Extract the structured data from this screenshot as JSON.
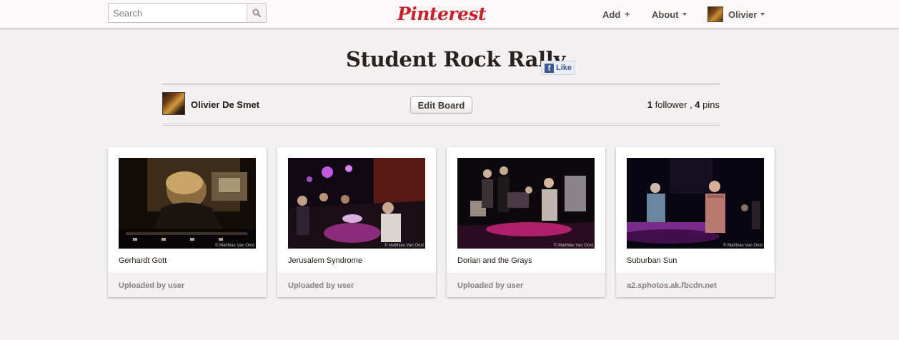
{
  "header": {
    "search_placeholder": "Search",
    "logo_text": "Pinterest",
    "add_label": "Add",
    "add_symbol": "+",
    "about_label": "About",
    "user_label": "Olivier",
    "brand_color": "#c8232c"
  },
  "board": {
    "title": "Student Rock Rally",
    "like_label": "Like",
    "fb_glyph": "f",
    "owner_name": "Olivier De Smet",
    "edit_label": "Edit Board",
    "followers_count": "1",
    "followers_word": " follower , ",
    "pins_count": "4",
    "pins_word": " pins"
  },
  "pins": [
    {
      "description": "Gerhardt Gott",
      "source": "Uploaded by user",
      "credit": "© Matthias Van Oost"
    },
    {
      "description": "Jerusalem Syndrome",
      "source": "Uploaded by user",
      "credit": "© Matthias Van Oost"
    },
    {
      "description": "Dorian and the Grays",
      "source": "Uploaded by user",
      "credit": "© Matthias Van Oost"
    },
    {
      "description": "Suburban Sun",
      "source": "a2.sphotos.ak.fbcdn.net",
      "credit": "© Matthias Van Oost"
    }
  ]
}
